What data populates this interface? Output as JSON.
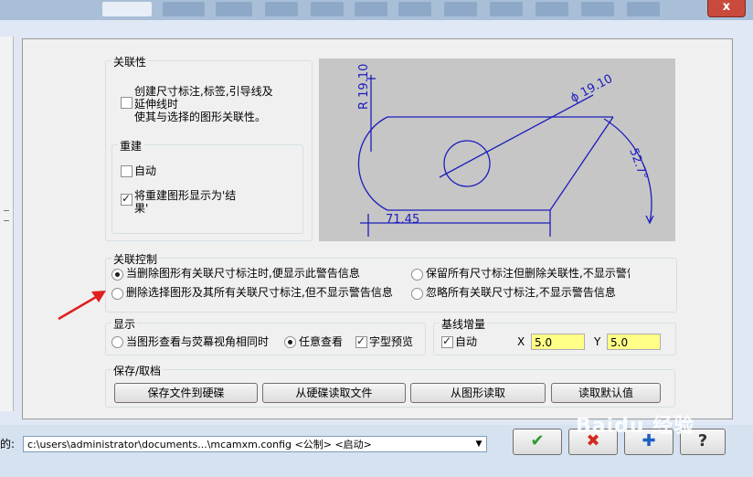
{
  "window": {
    "close_glyph": "x"
  },
  "association": {
    "title": "关联性",
    "create_checkbox": {
      "label": "创建尺寸标注,标签,引导线及\n延伸线时\n使其与选择的图形关联性。",
      "checked": false
    }
  },
  "rebuild": {
    "title": "重建",
    "auto": {
      "label": "自动",
      "checked": false
    },
    "display_result": {
      "label": "将重建图形显示为'结\n果'",
      "checked": true
    }
  },
  "preview": {
    "radius_label": "R 19.10",
    "diameter_label": "ϕ 19.10",
    "angle_label": "52.7°",
    "length_label": "71.45",
    "colors": {
      "background": "#c6c6c6",
      "geometry": "#1c1cbd"
    }
  },
  "assoc_control": {
    "title": "关联控制",
    "options": [
      {
        "label": "当删除图形有关联尺寸标注时,便显示此警告信息",
        "selected": true
      },
      {
        "label": "保留所有尺寸标注但删除关联性,不显示警告",
        "selected": false
      },
      {
        "label": "删除选择图形及其所有关联尺寸标注,但不显示警告信息",
        "selected": false
      },
      {
        "label": "忽略所有关联尺寸标注,不显示警告信息",
        "selected": false
      }
    ]
  },
  "display": {
    "title": "显示",
    "options": [
      {
        "label": "当图形查看与荧幕视角相同时",
        "selected": false
      },
      {
        "label": "任意查看",
        "selected": true
      }
    ],
    "font_preview": {
      "label": "字型预览",
      "checked": true
    }
  },
  "baseline": {
    "title": "基线增量",
    "auto": {
      "label": "自动",
      "checked": true
    },
    "x_label": "X",
    "x_value": "5.0",
    "y_label": "Y",
    "y_value": "5.0"
  },
  "save_load": {
    "title": "保存/取档",
    "buttons": [
      "保存文件到硬碟",
      "从硬碟读取文件",
      "从图形读取",
      "读取默认值"
    ]
  },
  "footer": {
    "config_prefix": "的:",
    "config_path": "c:\\users\\administrator\\documents...\\mcamxm.config <公制> <启动>",
    "ok_glyph": "✔",
    "cancel_glyph": "✖",
    "add_glyph": "✚",
    "help_glyph": "?"
  },
  "watermark": "Baidu 经验"
}
